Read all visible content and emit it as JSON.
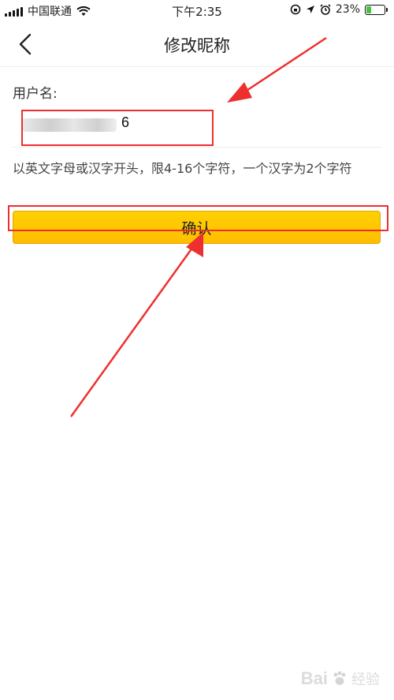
{
  "status_bar": {
    "carrier": "中国联通",
    "time": "下午2:35",
    "battery_percent": "23%",
    "battery_level": 0.23,
    "icons": [
      "signal-bars-icon",
      "wifi-icon",
      "lock-rotation-icon",
      "location-arrow-icon",
      "alarm-icon",
      "battery-charging-icon"
    ]
  },
  "nav": {
    "title": "修改昵称",
    "back_icon": "chevron-left-icon"
  },
  "form": {
    "username_label": "用户名:",
    "username_value_visible": "6",
    "hint": "以英文字母或汉字开头，限4-16个字符，一个汉字为2个字符",
    "confirm_label": "确认"
  },
  "watermark": {
    "text": "Bai",
    "sub": "经验"
  },
  "colors": {
    "accent": "#ffc400",
    "annotation_red": "#ee2f2f"
  }
}
